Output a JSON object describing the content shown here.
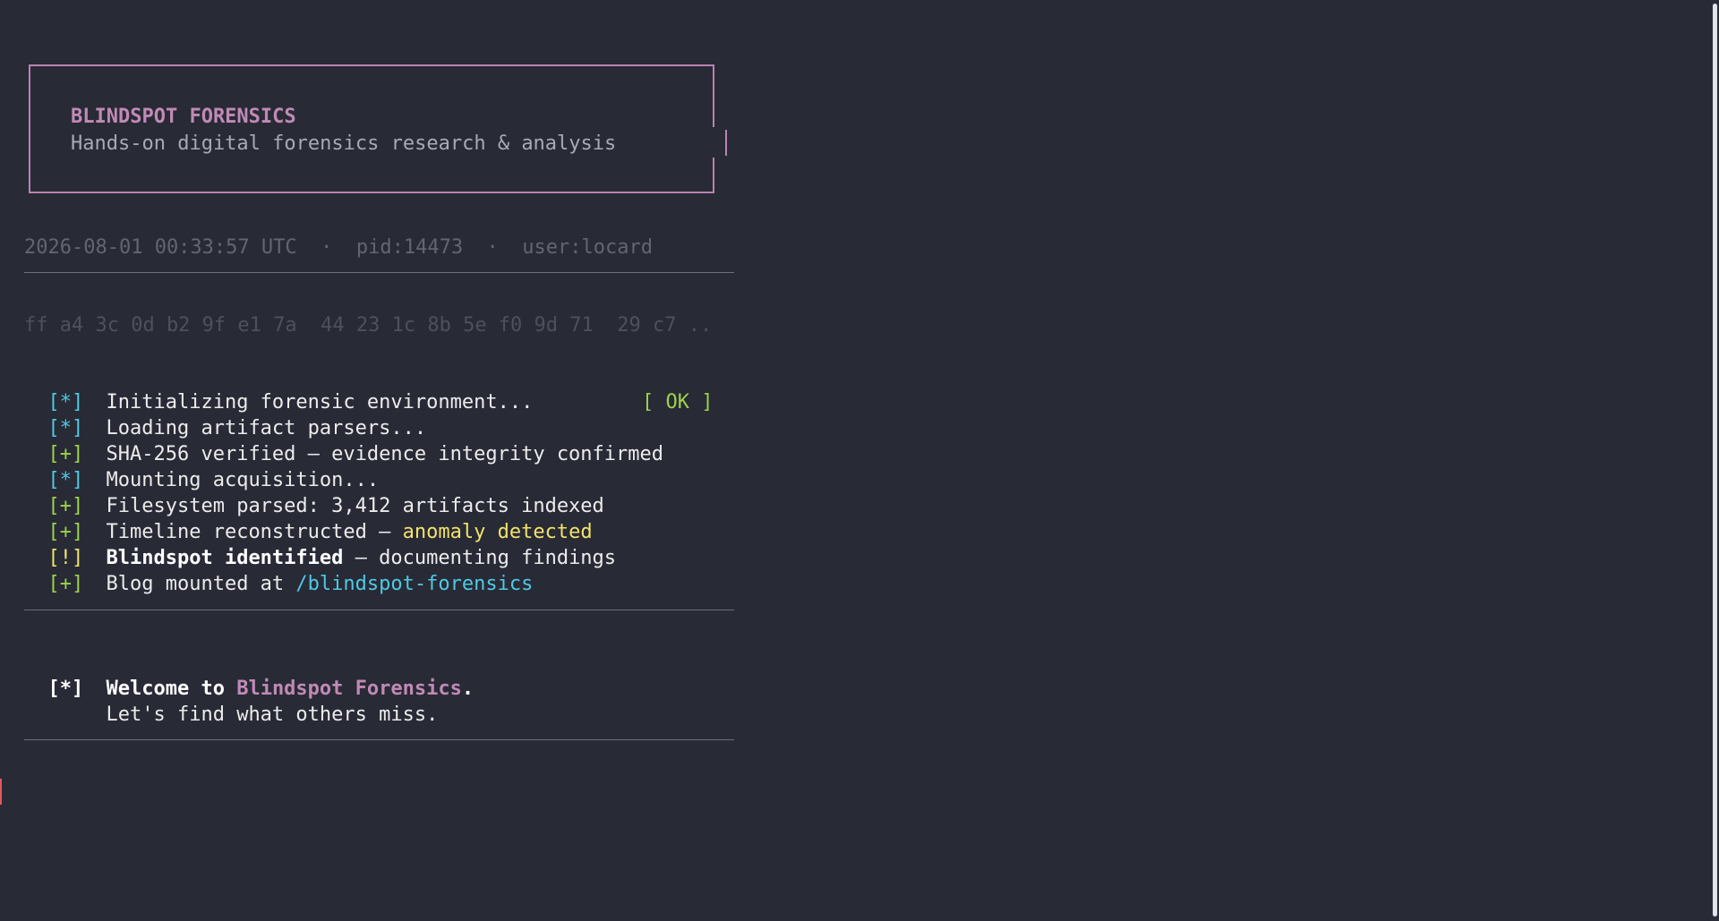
{
  "banner": {
    "title": "BLINDSPOT FORENSICS",
    "subtitle": "Hands-on digital forensics research & analysis"
  },
  "meta": {
    "line": "2026-08-01 00:33:57 UTC  ·  pid:14473  ·  user:locard"
  },
  "hex": {
    "line": "ff a4 3c 0d b2 9f e1 7a  44 23 1c 8b 5e f0 9d 71  29 c7 .."
  },
  "log": {
    "lines": [
      {
        "tag": "[*]",
        "text": "Initializing forensic environment..."
      },
      {
        "tag": "[*]",
        "text": "Loading artifact parsers...",
        "status": "[ OK ]"
      },
      {
        "tag": "[+]",
        "text": "SHA-256 verified — evidence integrity confirmed"
      },
      {
        "tag": "[*]",
        "text": "Mounting acquisition..."
      },
      {
        "tag": "[+]",
        "text": "Filesystem parsed: 3,412 artifacts indexed"
      },
      {
        "tag": "[+]",
        "text_a": "Timeline reconstructed — ",
        "text_b": "anomaly detected"
      },
      {
        "tag": "[!]",
        "text_a": "Blindspot identified",
        "text_b": " — documenting findings"
      },
      {
        "tag": "[+]",
        "text_a": "Blog mounted at ",
        "text_b": "/blindspot-forensics"
      }
    ]
  },
  "welcome": {
    "tag": "[*]",
    "prefix": "Welcome to ",
    "brand": "Blindspot Forensics",
    "suffix": ".",
    "line2": "Let's find what others miss."
  },
  "colors": {
    "background": "#282a36",
    "accent_pink": "#c18ab5",
    "info_cyan": "#4fc9e3",
    "ok_green": "#9bd34a",
    "warn_yellow": "#f2e36b"
  }
}
